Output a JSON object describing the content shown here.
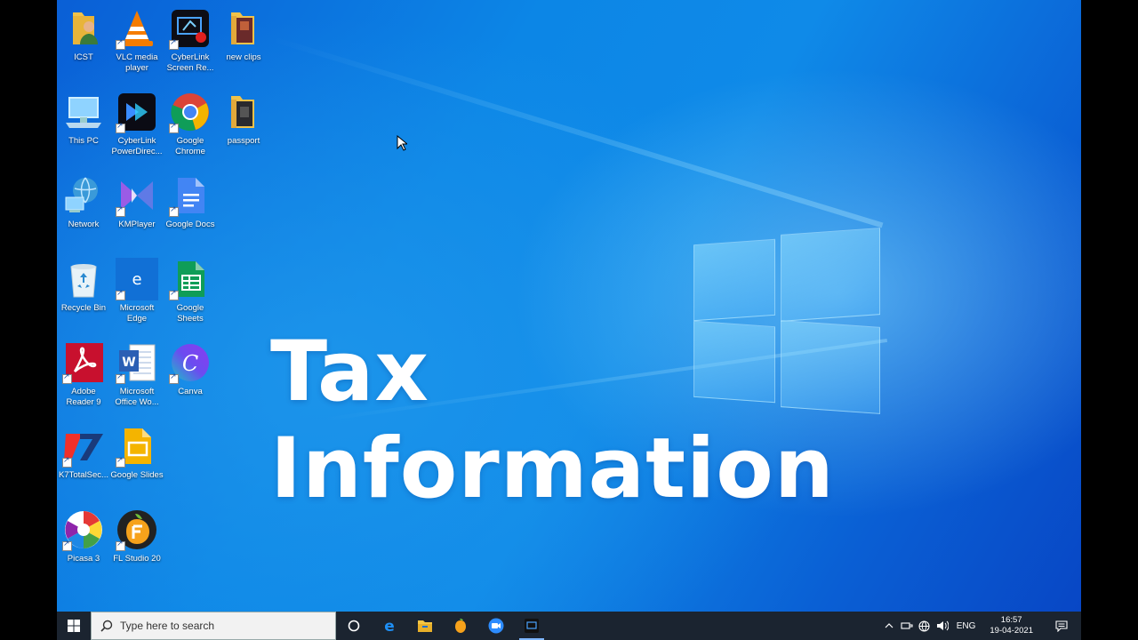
{
  "desktop": {
    "title_overlay": "Tax Information",
    "icons": [
      {
        "label": "ICST",
        "icon": "folder-user-icon"
      },
      {
        "label": "VLC media player",
        "icon": "vlc-icon"
      },
      {
        "label": "CyberLink Screen Re...",
        "icon": "cyberlink-screen-recorder-icon"
      },
      {
        "label": "new clips",
        "icon": "folder-icon"
      },
      {
        "label": "This PC",
        "icon": "computer-icon"
      },
      {
        "label": "CyberLink PowerDirec...",
        "icon": "cyberlink-powerdirector-icon"
      },
      {
        "label": "Google Chrome",
        "icon": "chrome-icon"
      },
      {
        "label": "passport",
        "icon": "folder-icon"
      },
      {
        "label": "Network",
        "icon": "network-icon"
      },
      {
        "label": "KMPlayer",
        "icon": "kmplayer-icon"
      },
      {
        "label": "Google Docs",
        "icon": "google-docs-icon"
      },
      {
        "label": "Recycle Bin",
        "icon": "recycle-bin-icon"
      },
      {
        "label": "Microsoft Edge",
        "icon": "edge-icon"
      },
      {
        "label": "Google Sheets",
        "icon": "google-sheets-icon"
      },
      {
        "label": "Adobe Reader 9",
        "icon": "adobe-reader-icon"
      },
      {
        "label": "Microsoft Office Wo...",
        "icon": "word-icon"
      },
      {
        "label": "Canva",
        "icon": "canva-icon"
      },
      {
        "label": "K7TotalSec...",
        "icon": "k7-icon"
      },
      {
        "label": "Google Slides",
        "icon": "google-slides-icon"
      },
      {
        "label": "Picasa 3",
        "icon": "picasa-icon"
      },
      {
        "label": "FL Studio 20",
        "icon": "fl-studio-icon"
      }
    ]
  },
  "taskbar": {
    "search_placeholder": "Type here to search",
    "language": "ENG",
    "time": "16:57",
    "date": "19-04-2021"
  },
  "colors": {
    "taskbar_bg": "#1b2430",
    "desktop_blue": "#0c86e6"
  }
}
